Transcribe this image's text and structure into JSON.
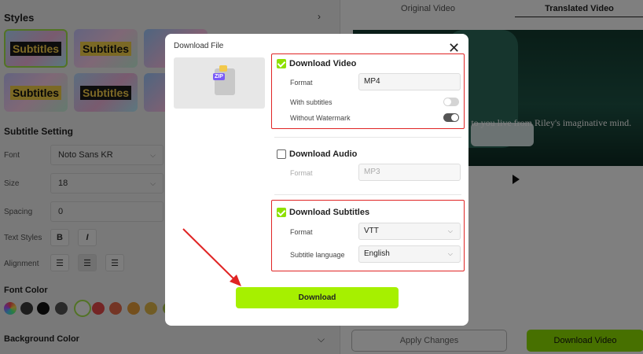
{
  "settings": {
    "styles_title": "Styles",
    "style_presets": [
      "Subtitles",
      "Subtitles",
      "Su",
      "Subtitles",
      "Subtitles",
      "Su"
    ],
    "subtitle_setting_title": "Subtitle Setting",
    "font_label": "Font",
    "font_value": "Noto Sans KR",
    "size_label": "Size",
    "size_value": "18",
    "spacing_label": "Spacing",
    "spacing_value": "0",
    "text_styles_label": "Text Styles",
    "bold_label": "B",
    "italic_label": "I",
    "alignment_label": "Alignment",
    "font_color_title": "Font Color",
    "font_colors": [
      "#3a3a3a",
      "#111111",
      "#555555",
      "#ffffff",
      "#e84a4a",
      "#e96b4a",
      "#e99f3a",
      "#e3b84a",
      "#a9c24a",
      "#7fb24a"
    ],
    "background_color_title": "Background Color"
  },
  "preview": {
    "tabs": [
      "Original Video",
      "Translated Video"
    ],
    "active_tab": "Translated Video",
    "subtitle_text": "ing to you live from Riley's imaginative mind.",
    "apply_label": "Apply Changes",
    "download_video_label": "Download Video",
    "accent_color": "#8ee000"
  },
  "modal": {
    "title": "Download File",
    "zip_label": "ZIP",
    "video": {
      "label": "Download Video",
      "checked": true,
      "format_label": "Format",
      "format_value": "MP4",
      "with_subtitles_label": "With subtitles",
      "with_subtitles_on": false,
      "without_watermark_label": "Without Watermark",
      "without_watermark_on": true
    },
    "audio": {
      "label": "Download Audio",
      "checked": false,
      "format_label": "Format",
      "format_value": "MP3"
    },
    "subtitles": {
      "label": "Download Subtitles",
      "checked": true,
      "format_label": "Format",
      "format_value": "VTT",
      "language_label": "Subtitle language",
      "language_value": "English"
    },
    "download_label": "Download",
    "highlight_color": "#e02424"
  }
}
